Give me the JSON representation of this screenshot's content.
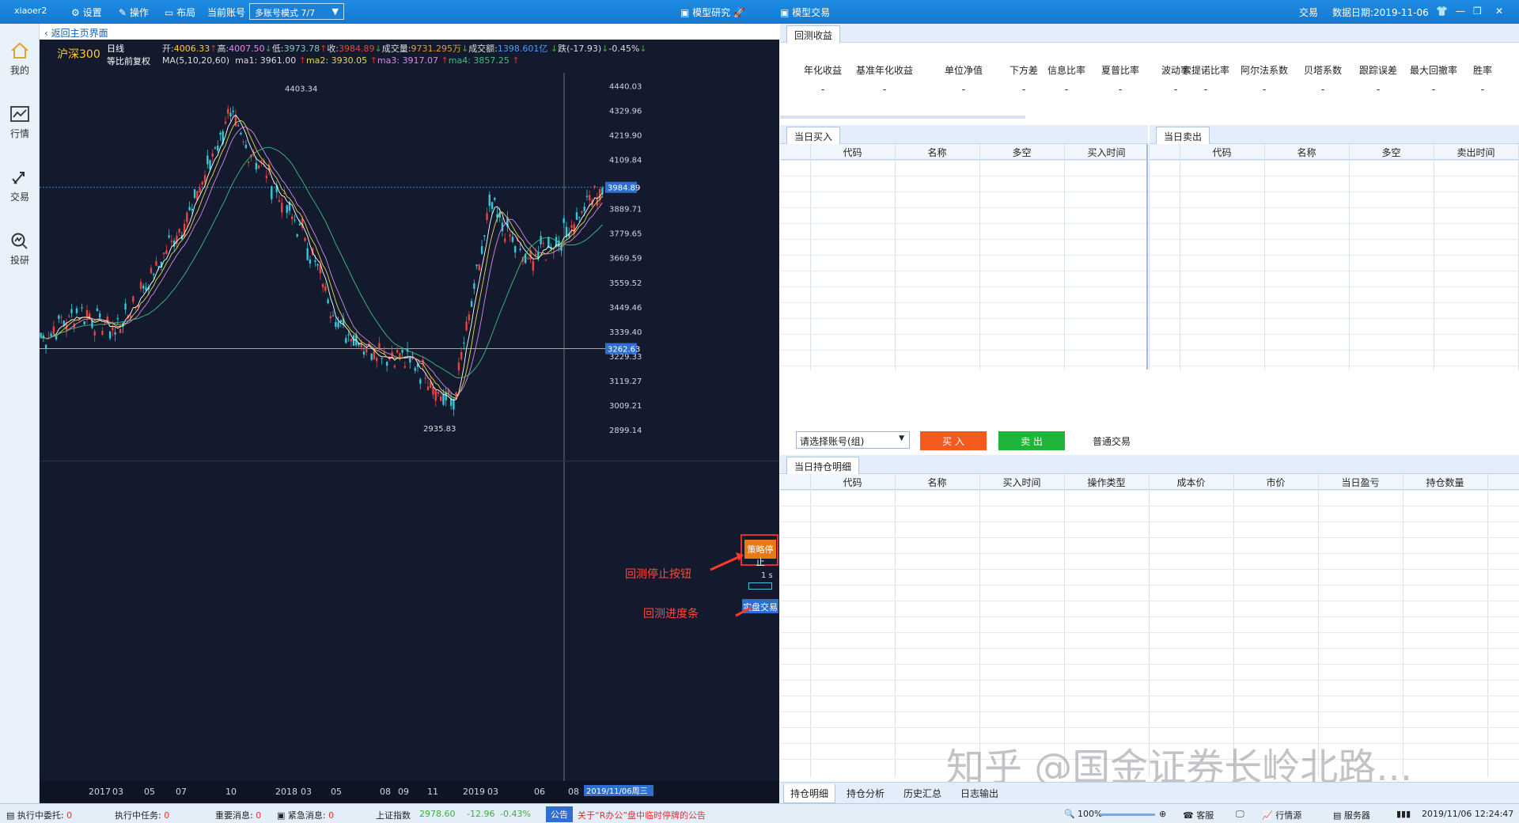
{
  "titlebar": {
    "user": "xiaoer2",
    "settings": "设置",
    "operate": "操作",
    "layout": "布局",
    "account_label": "当前账号",
    "account_mode": "多账号模式 7/7",
    "model_research": "模型研究",
    "model_trade": "模型交易",
    "trade": "交易",
    "data_date": "数据日期:2019-11-06"
  },
  "nav": [
    {
      "label": "我的",
      "icon": "home-icon"
    },
    {
      "label": "行情",
      "icon": "chart-icon"
    },
    {
      "label": "交易",
      "icon": "trade-arrows-icon"
    },
    {
      "label": "投研",
      "icon": "research-icon"
    }
  ],
  "chart": {
    "back_label": "返回主页界面",
    "symbol": "沪深300",
    "period": "日线",
    "adjust": "等比前复权",
    "open_label": "开:",
    "open": "4006.33",
    "high_label": "高:",
    "high": "4007.50",
    "low_label": "低:",
    "low": "3973.78",
    "close_label": "收:",
    "close": "3984.89",
    "volume_label": "成交量:",
    "volume": "9731.295万",
    "amount_label": "成交额:",
    "amount": "1398.601亿",
    "change_label": "跌(-17.93)",
    "change_pct": "-0.45%",
    "ma_label": "MA(5,10,20,60)",
    "ma1_label": "ma1:",
    "ma1": "3961.00",
    "ma2_label": "ma2:",
    "ma2": "3930.05",
    "ma3_label": "ma3:",
    "ma3": "3917.07",
    "ma4_label": "ma4:",
    "ma4": "3857.25",
    "high_marker": "4403.34",
    "low_marker": "2935.83",
    "price_ticks": [
      "4440.03",
      "4329.96",
      "4219.90",
      "4109.84",
      "3889.71",
      "3779.65",
      "3669.59",
      "3559.52",
      "3449.46",
      "3339.40",
      "3229.33",
      "3119.27",
      "3009.21",
      "2899.14"
    ],
    "current_price_tag": "3984.89",
    "crosshair_price_tag": "3262.63",
    "x_ticks": [
      "2017",
      "03",
      "05",
      "07",
      "10",
      "2018",
      "03",
      "05",
      "08",
      "09",
      "11",
      "2019",
      "03",
      "06",
      "08"
    ],
    "date_tag": "2019/11/06周三",
    "stop_button": "策略停止",
    "progress_label": "1 s",
    "live_button": "实盘交易",
    "annotation_stop": "回测停止按钮",
    "annotation_progress": "回测进度条",
    "colors": {
      "bg": "#141a2e",
      "up": "#e8453c",
      "down": "#35c7d6",
      "ma1": "#ffffff",
      "ma2": "#e5d84a",
      "ma3": "#d88ae0",
      "ma4": "#3fbf7f"
    }
  },
  "chart_data": {
    "type": "candlestick",
    "title": "沪深300",
    "xlabel": "",
    "ylabel": "",
    "ylim": [
      2899.14,
      4440.03
    ],
    "x": [
      "2017-01",
      "2017-03",
      "2017-05",
      "2017-07",
      "2017-10",
      "2018-01",
      "2018-03",
      "2018-05",
      "2018-08",
      "2018-09",
      "2018-11",
      "2019-01",
      "2019-03",
      "2019-06",
      "2019-08",
      "2019-11"
    ],
    "y": [
      3310,
      3420,
      3350,
      3600,
      3880,
      4300,
      4050,
      3780,
      3350,
      3250,
      3200,
      3000,
      3900,
      3650,
      3780,
      3984.89
    ],
    "annotations": [
      {
        "label": "4403.34",
        "value": 4403.34
      },
      {
        "label": "2935.83",
        "value": 2935.83
      }
    ]
  },
  "backtest": {
    "tab": "回测收益",
    "metrics": [
      {
        "name": "年化收益",
        "value": "-"
      },
      {
        "name": "基准年化收益",
        "value": "-"
      },
      {
        "name": "单位净值",
        "value": "-"
      },
      {
        "name": "下方差",
        "value": "-"
      },
      {
        "name": "信息比率",
        "value": "-"
      },
      {
        "name": "夏普比率",
        "value": "-"
      },
      {
        "name": "波动率",
        "value": "-"
      },
      {
        "name": "索提诺比率",
        "value": "-"
      },
      {
        "name": "阿尔法系数",
        "value": "-"
      },
      {
        "name": "贝塔系数",
        "value": "-"
      },
      {
        "name": "跟踪误差",
        "value": "-"
      },
      {
        "name": "最大回撤率",
        "value": "-"
      },
      {
        "name": "胜率",
        "value": "-"
      }
    ]
  },
  "buy": {
    "tab": "当日买入",
    "columns": [
      "代码",
      "名称",
      "多空",
      "买入时间"
    ]
  },
  "sell": {
    "tab": "当日卖出",
    "columns": [
      "代码",
      "名称",
      "多空",
      "卖出时间"
    ]
  },
  "order": {
    "account_placeholder": "请选择账号(组)",
    "buy_button": "买 入",
    "sell_button": "卖 出",
    "normal_trade": "普通交易"
  },
  "positions": {
    "tab": "当日持仓明细",
    "columns": [
      "代码",
      "名称",
      "买入时间",
      "操作类型",
      "成本价",
      "市价",
      "当日盈亏",
      "持仓数量"
    ]
  },
  "bottom_tabs": [
    "持仓明细",
    "持仓分析",
    "历史汇总",
    "日志输出"
  ],
  "watermark": "知乎 @国金证券长岭北路...",
  "status": {
    "pending_label": "执行中委托:",
    "pending": "0",
    "tasks_label": "执行中任务:",
    "tasks": "0",
    "important_label": "重要消息:",
    "important": "0",
    "urgent_label": "紧急消息:",
    "urgent": "0",
    "index_name": "上证指数",
    "index_value": "2978.60",
    "index_change": "-12.96",
    "index_pct": "-0.43%",
    "notice_label": "公告",
    "notice_text": "关于“R办公”盘中临时停牌的公告",
    "zoom": "100%",
    "service": "客服",
    "quote_source": "行情源",
    "server": "服务器",
    "datetime": "2019/11/06 12:24:47"
  }
}
